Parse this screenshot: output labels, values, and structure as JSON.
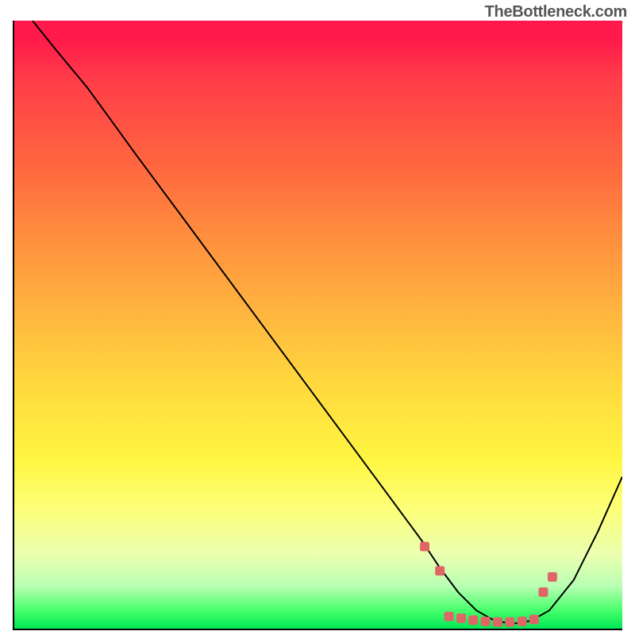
{
  "attribution": "TheBottleneck.com",
  "chart_data": {
    "type": "line",
    "title": "",
    "xlabel": "",
    "ylabel": "",
    "xlim": [
      0,
      100
    ],
    "ylim": [
      0,
      100
    ],
    "series": [
      {
        "name": "bottleneck-curve",
        "x": [
          3,
          7,
          12,
          20,
          30,
          40,
          50,
          60,
          67,
          70,
          73,
          76,
          79,
          82,
          85,
          88,
          92,
          96,
          100
        ],
        "y": [
          100,
          95,
          89,
          78,
          64.5,
          51,
          37.5,
          24,
          14.5,
          10,
          6,
          3,
          1.3,
          0.8,
          1.3,
          3,
          8,
          16,
          25
        ]
      }
    ],
    "markers": {
      "name": "optimal-range-markers",
      "color": "#e06666",
      "points": [
        {
          "x": 67.5,
          "y": 13.5
        },
        {
          "x": 70,
          "y": 9.5
        },
        {
          "x": 71.5,
          "y": 2.0
        },
        {
          "x": 73.5,
          "y": 1.7
        },
        {
          "x": 75.5,
          "y": 1.4
        },
        {
          "x": 77.5,
          "y": 1.2
        },
        {
          "x": 79.5,
          "y": 1.1
        },
        {
          "x": 81.5,
          "y": 1.1
        },
        {
          "x": 83.5,
          "y": 1.2
        },
        {
          "x": 85.5,
          "y": 1.5
        },
        {
          "x": 87.0,
          "y": 6.0
        },
        {
          "x": 88.5,
          "y": 8.5
        }
      ]
    },
    "gradient_stops": [
      {
        "pos": 0,
        "color": "#ff1a4b"
      },
      {
        "pos": 25,
        "color": "#ff6a3f"
      },
      {
        "pos": 50,
        "color": "#ffc53e"
      },
      {
        "pos": 72,
        "color": "#fff541"
      },
      {
        "pos": 88,
        "color": "#eaffb0"
      },
      {
        "pos": 100,
        "color": "#00e856"
      }
    ]
  }
}
